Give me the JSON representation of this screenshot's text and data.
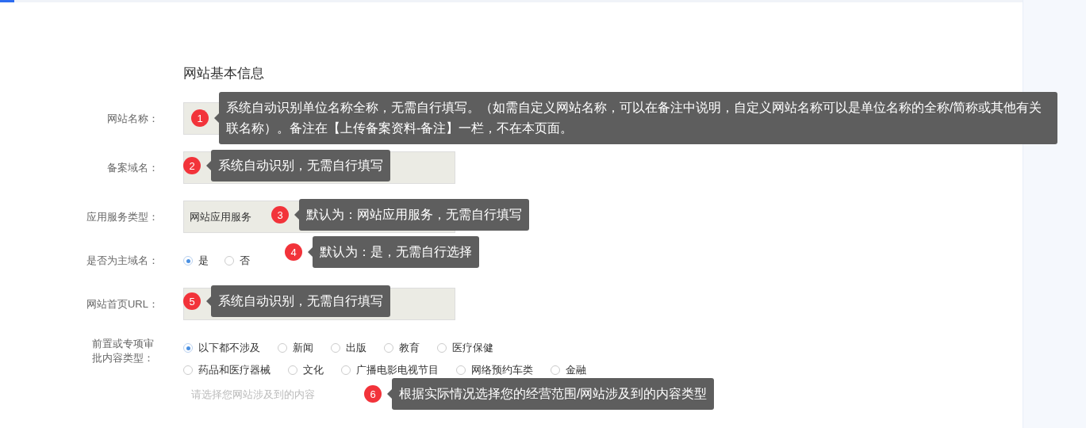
{
  "section_title": "网站基本信息",
  "fields": [
    {
      "label": "网站名称：",
      "kind": "input",
      "annotation": {
        "number": "1",
        "text": "系统自动识别单位名称全称，无需自行填写。（如需自定义网站名称，可以在备注中说明，自定义网站名称可以是单位名称的全称/简称或其他有关联名称）。备注在【上传备案资料-备注】一栏，不在本页面。"
      }
    },
    {
      "label": "备案域名：",
      "kind": "input",
      "annotation": {
        "number": "2",
        "text": "系统自动识别，无需自行填写"
      }
    },
    {
      "label": "应用服务类型：",
      "kind": "input",
      "value": "网站应用服务",
      "annotation": {
        "number": "3",
        "text": "默认为：网站应用服务，无需自行填写"
      }
    },
    {
      "label": "是否为主域名：",
      "kind": "radio",
      "options": [
        {
          "label": "是",
          "selected": true
        },
        {
          "label": "否",
          "selected": false
        }
      ],
      "annotation": {
        "number": "4",
        "text": "默认为：是，无需自行选择"
      }
    },
    {
      "label": "网站首页URL：",
      "kind": "input",
      "annotation": {
        "number": "5",
        "text": "系统自动识别，无需自行填写"
      }
    },
    {
      "label": "前置或专项审批内容类型：",
      "kind": "radio",
      "option_rows": [
        [
          {
            "label": "以下都不涉及",
            "selected": true
          },
          {
            "label": "新闻",
            "selected": false
          },
          {
            "label": "出版",
            "selected": false
          },
          {
            "label": "教育",
            "selected": false
          },
          {
            "label": "医疗保健",
            "selected": false
          }
        ],
        [
          {
            "label": "药品和医疗器械",
            "selected": false
          },
          {
            "label": "文化",
            "selected": false
          },
          {
            "label": "广播电影电视节目",
            "selected": false
          },
          {
            "label": "网络预约车类",
            "selected": false
          },
          {
            "label": "金融",
            "selected": false
          }
        ]
      ],
      "hint": "请选择您网站涉及到的内容",
      "annotation": {
        "number": "6",
        "text": "根据实际情况选择您的经营范围/网站涉及到的内容类型"
      }
    }
  ]
}
